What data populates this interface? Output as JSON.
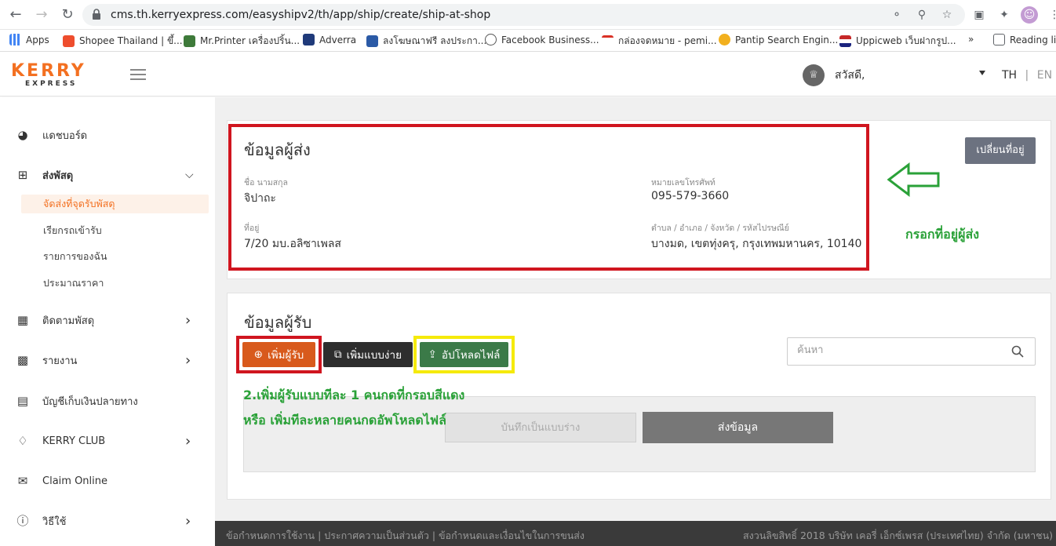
{
  "browser": {
    "url": "cms.th.kerryexpress.com/easyshipv2/th/app/ship/create/ship-at-shop",
    "bookmarks": [
      {
        "label": "Apps",
        "color": "#4285f4"
      },
      {
        "label": "Shopee Thailand | ขึ้...",
        "color": "#ee4d2d"
      },
      {
        "label": "Mr.Printer เครื่องปริ้น...",
        "color": "#3e7a3a"
      },
      {
        "label": "Adverra",
        "color": "#1f3a7a"
      },
      {
        "label": "ลงโฆษณาฟรี ลงประกา...",
        "color": "#2b5aa6"
      },
      {
        "label": "Facebook Business...",
        "color": "#555555"
      },
      {
        "label": "กล่องจดหมาย - pemi...",
        "color": "#d93025"
      },
      {
        "label": "Pantip Search Engin...",
        "color": "#f2b01e"
      },
      {
        "label": "Uppicweb เว็บฝากรูป...",
        "color": "#c62828"
      },
      {
        "label": "Reading lis",
        "color": "#5f6368"
      }
    ]
  },
  "header": {
    "logo_main": "KERRY",
    "logo_sub": "EXPRESS",
    "greeting": "สวัสดี,",
    "lang_th": "TH",
    "lang_sep": "|",
    "lang_en": "EN"
  },
  "sidebar": {
    "items": [
      {
        "label": "แดชบอร์ด",
        "icon": "speedometer-icon"
      },
      {
        "label": "ส่งพัสดุ",
        "icon": "add-package-icon"
      },
      {
        "label": "ติดตามพัสดุ",
        "icon": "track-package-icon"
      },
      {
        "label": "รายงาน",
        "icon": "chart-icon"
      },
      {
        "label": "บัญชีเก็บเงินปลายทาง",
        "icon": "cod-book-icon"
      },
      {
        "label": "KERRY CLUB",
        "icon": "kerry-club-icon"
      },
      {
        "label": "Claim Online",
        "icon": "claim-icon"
      },
      {
        "label": "วิธีใช้",
        "icon": "info-icon"
      }
    ],
    "sub_items": [
      "จัดส่งที่จุดรับพัสดุ",
      "เรียกรถเข้ารับ",
      "รายการของฉัน",
      "ประมาณราคา"
    ]
  },
  "sender": {
    "title": "ข้อมูลผู้ส่ง",
    "name_label": "ชื่อ นามสกุล",
    "name_value": "จิปาถะ",
    "phone_label": "หมายเลขโทรศัพท์",
    "phone_value": "095-579-3660",
    "address_label": "ที่อยู่",
    "address_value": "7/20 มบ.อลิซาเพลส",
    "district_label": "ตำบล / อำเภอ / จังหวัด / รหัสไปรษณีย์",
    "district_value": "บางมด, เขตทุ่งครุ, กรุงเทพมหานคร, 10140",
    "change_address_btn": "เปลี่ยนที่อยู่",
    "annotation": "กรอกที่อยู่ผู้ส่ง"
  },
  "receiver": {
    "title": "ข้อมูลผู้รับ",
    "add_btn": "เพิ่มผู้รับ",
    "add_simple_btn": "เพิ่มแบบง่าย",
    "upload_btn": "อัปโหลดไฟล์",
    "search_placeholder": "ค้นหา",
    "annotation_line1": "2.เพิ่มผู้รับแบบทีละ 1 คนกดที่กรอบสีแดง",
    "annotation_line2": "หรือ เพิ่มทีละหลายคนกดอัพโหลดไฟล์",
    "draft_btn": "บันทึกเป็นแบบร่าง",
    "submit_btn": "ส่งข้อมูล"
  },
  "footer": {
    "links": "ข้อกำหนดการใช้งาน | ประกาศความเป็นส่วนตัว | ข้อกำหนดและเงื่อนไขในการขนส่ง",
    "copyright": "สงวนลิขสิทธิ์ 2018 บริษัท เคอรี่ เอ็กซ์เพรส (ประเทศไทย) จำกัด (มหาชน)"
  },
  "colors": {
    "brand_orange": "#f37021",
    "annotation_red": "#d0151f",
    "annotation_yellow": "#f5ea0a",
    "annotation_green": "#2aa138"
  }
}
